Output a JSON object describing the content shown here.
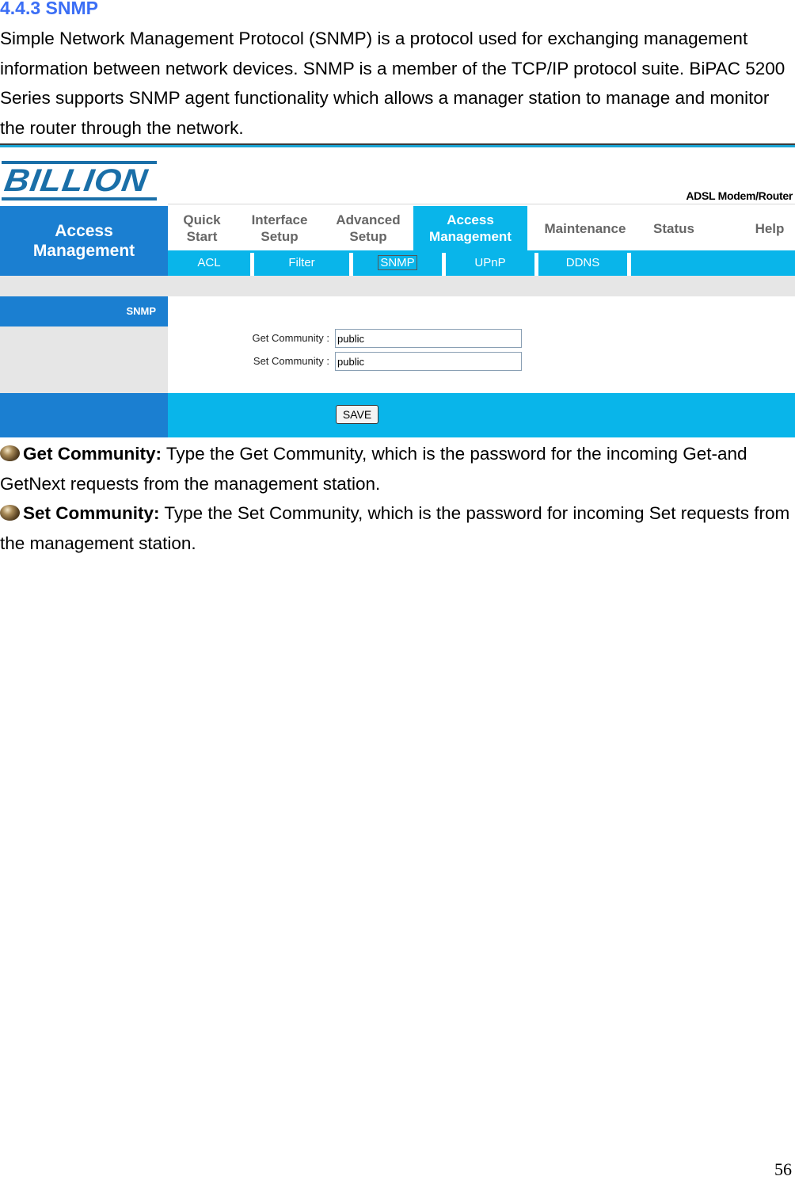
{
  "section": {
    "heading": "4.4.3 SNMP",
    "intro": "Simple Network Management Protocol (SNMP) is a protocol used for exchanging management information between network devices. SNMP is a member of the TCP/IP protocol suite. BiPAC 5200 Series supports SNMP agent functionality which allows a manager station to manage and monitor the router through the network."
  },
  "router_ui": {
    "logo_text": "BILLION",
    "product_label": "ADSL Modem/Router",
    "sidebar_title_line1": "Access",
    "sidebar_title_line2": "Management",
    "top_tabs": [
      {
        "line1": "Quick",
        "line2": "Start"
      },
      {
        "line1": "Interface",
        "line2": "Setup"
      },
      {
        "line1": "Advanced",
        "line2": "Setup"
      },
      {
        "line1": "Access",
        "line2": "Management",
        "active": true
      },
      {
        "line1": "Maintenance",
        "line2": ""
      },
      {
        "line1": "Status",
        "line2": ""
      },
      {
        "line1": "Help",
        "line2": ""
      }
    ],
    "sub_tabs": [
      "ACL",
      "Filter",
      "SNMP",
      "UPnP",
      "DDNS"
    ],
    "active_sub_tab": "SNMP",
    "section_label": "SNMP",
    "fields": [
      {
        "label": "Get Community :",
        "value": "public"
      },
      {
        "label": "Set Community :",
        "value": "public"
      }
    ],
    "save_label": "SAVE",
    "colors": {
      "dark_blue": "#1b7fd1",
      "light_blue": "#09b5ea",
      "grey": "#e6e6e6"
    }
  },
  "descriptions": [
    {
      "term": "Get Community:",
      "text": " Type the Get Community, which is the password for the incoming Get-and GetNext requests from the management station."
    },
    {
      "term": "Set Community:",
      "text": " Type the Set Community, which is the password for incoming Set requests from the management station."
    }
  ],
  "page_number": "56"
}
